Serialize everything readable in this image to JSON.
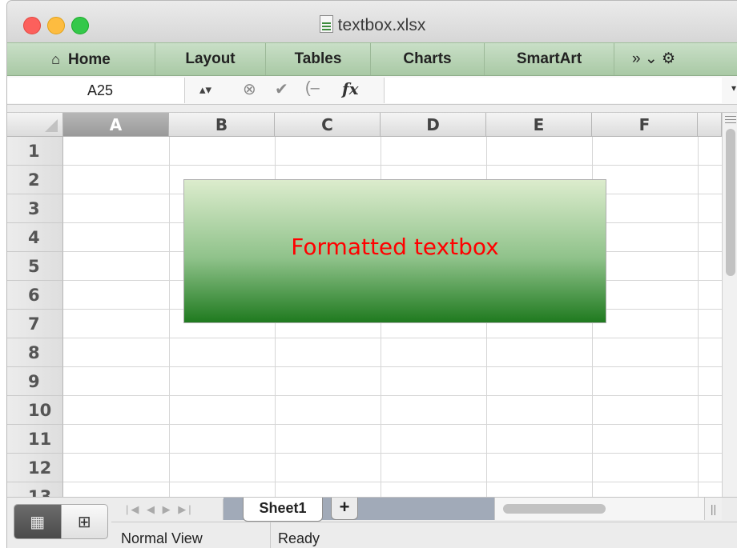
{
  "window": {
    "title": "textbox.xlsx"
  },
  "ribbon": {
    "tabs": [
      "Home",
      "Layout",
      "Tables",
      "Charts",
      "SmartArt"
    ],
    "more_label": "»  ⌄  ⚙"
  },
  "formula_bar": {
    "name_box": "A25",
    "fx_label": "fx",
    "value": ""
  },
  "grid": {
    "columns": [
      "A",
      "B",
      "C",
      "D",
      "E",
      "F"
    ],
    "selected_column": "A",
    "rows": [
      "1",
      "2",
      "3",
      "4",
      "5",
      "6",
      "7",
      "8",
      "9",
      "10",
      "11",
      "12",
      "13"
    ]
  },
  "textbox": {
    "text": "Formatted textbox"
  },
  "sheet_tabs": {
    "active": "Sheet1",
    "add_label": "+"
  },
  "status_bar": {
    "view": "Normal View",
    "state": "Ready"
  },
  "colors": {
    "ribbon": "#b5d3b1",
    "textbox_text": "#ff0000",
    "textbox_dark": "#1f7a1f"
  }
}
